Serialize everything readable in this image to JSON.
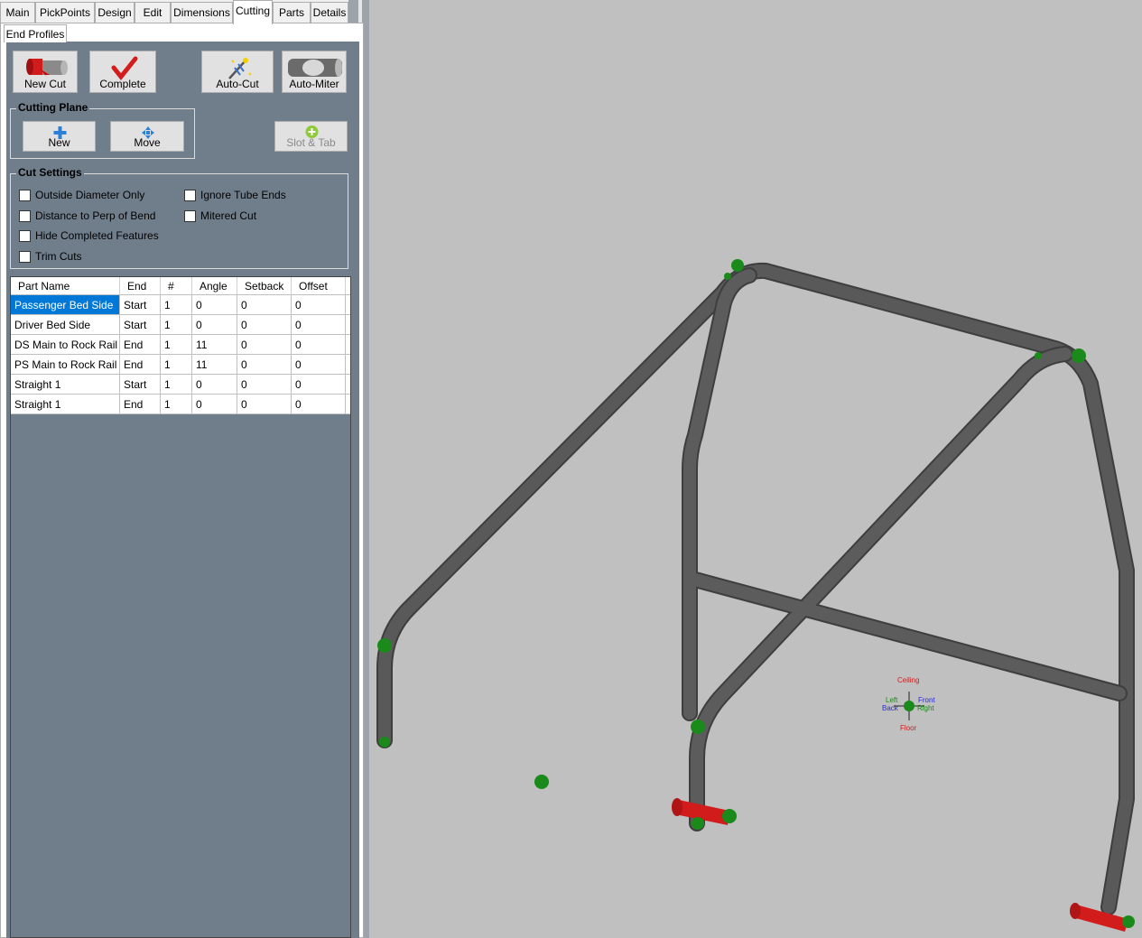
{
  "tabs": [
    "Main",
    "PickPoints",
    "Design",
    "Edit",
    "Dimensions",
    "Cutting",
    "Parts",
    "Details"
  ],
  "active_tab": "Cutting",
  "subtab": "End Profiles",
  "toolbar": {
    "new_cut": "New Cut",
    "complete": "Complete",
    "auto_cut": "Auto-Cut",
    "auto_miter": "Auto-Miter"
  },
  "cutting_plane": {
    "title": "Cutting Plane",
    "new": "New",
    "move": "Move",
    "slot_tab": "Slot & Tab"
  },
  "cut_settings": {
    "title": "Cut Settings",
    "outside_diameter_only": "Outside Diameter Only",
    "ignore_tube_ends": "Ignore Tube Ends",
    "distance_to_perp": "Distance to Perp of Bend",
    "mitered_cut": "Mitered Cut",
    "hide_completed": "Hide Completed Features",
    "trim_cuts": "Trim Cuts"
  },
  "table": {
    "headers": [
      "Part Name",
      "End",
      "#",
      "Angle",
      "Setback",
      "Offset"
    ],
    "rows": [
      [
        "Passenger Bed Side",
        "Start",
        "1",
        "0",
        "0",
        "0"
      ],
      [
        "Driver Bed Side",
        "Start",
        "1",
        "0",
        "0",
        "0"
      ],
      [
        "DS Main to Rock Rail",
        "End",
        "1",
        "11",
        "0",
        "0"
      ],
      [
        "PS Main to Rock Rail",
        "End",
        "1",
        "11",
        "0",
        "0"
      ],
      [
        "Straight 1",
        "Start",
        "1",
        "0",
        "0",
        "0"
      ],
      [
        "Straight 1",
        "End",
        "1",
        "0",
        "0",
        "0"
      ]
    ],
    "selected_row": 0
  },
  "triad": {
    "ceiling": "Ceiling",
    "left": "Left",
    "back": "Back",
    "front": "Front",
    "right": "Right",
    "floor": "Floor"
  },
  "colors": {
    "panel": "#707e8c",
    "selection": "#0078d7",
    "tube": "#5a5a5a",
    "pick_point": "#1a8a1a",
    "cut_marker": "#d41c1c"
  }
}
